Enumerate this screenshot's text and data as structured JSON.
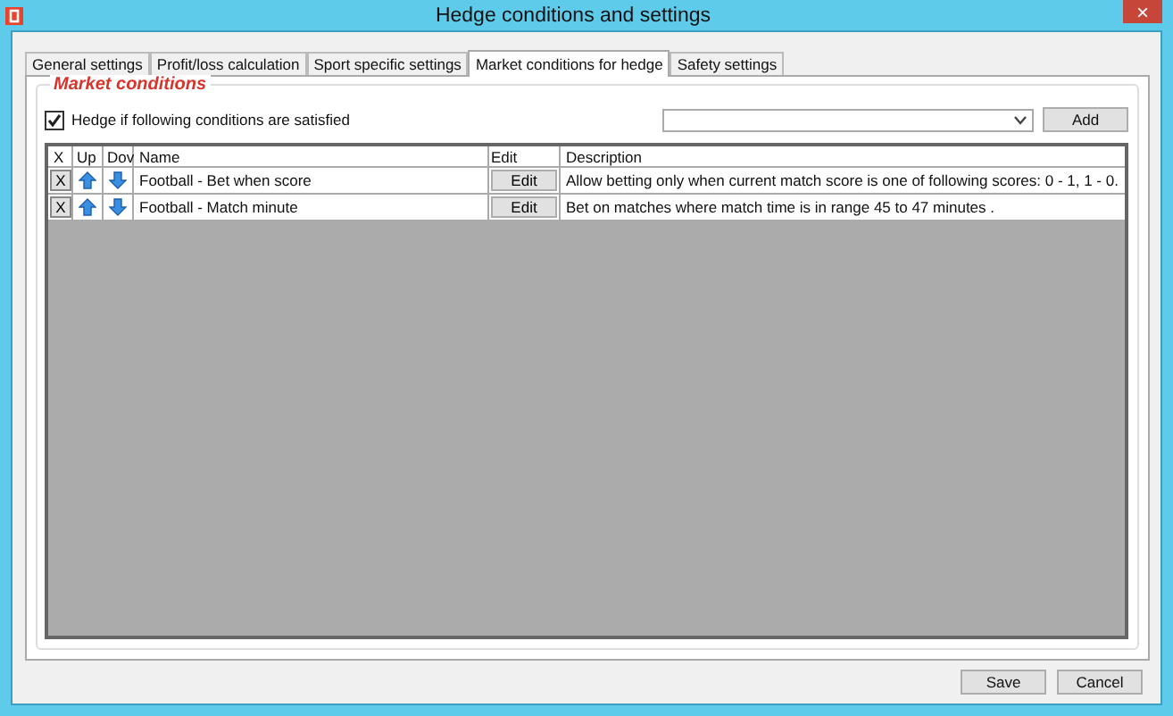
{
  "window": {
    "title": "Hedge conditions and settings",
    "close": "×"
  },
  "tabs": [
    {
      "label": "General settings",
      "selected": false
    },
    {
      "label": "Profit/loss calculation",
      "selected": false
    },
    {
      "label": "Sport specific settings",
      "selected": false
    },
    {
      "label": "Market conditions for hedge",
      "selected": true
    },
    {
      "label": "Safety settings",
      "selected": false
    }
  ],
  "group": {
    "title": "Market conditions",
    "checkbox": {
      "label": "Hedge if following conditions are satisfied",
      "checked": true
    },
    "add_button": "Add"
  },
  "table": {
    "columns": [
      "X",
      "Up",
      "Dov",
      "Name",
      "Edit",
      "Description"
    ],
    "rows": [
      {
        "remove": "X",
        "name": "Football - Bet when score",
        "edit": "Edit",
        "description": "Allow betting only when current match score is one of following scores: 0 - 1, 1 - 0."
      },
      {
        "remove": "X",
        "name": "Football - Match minute",
        "edit": "Edit",
        "description": "Bet on matches where match time is in range 45 to 47 minutes ."
      }
    ]
  },
  "buttons": [
    "Save",
    "Cancel"
  ]
}
